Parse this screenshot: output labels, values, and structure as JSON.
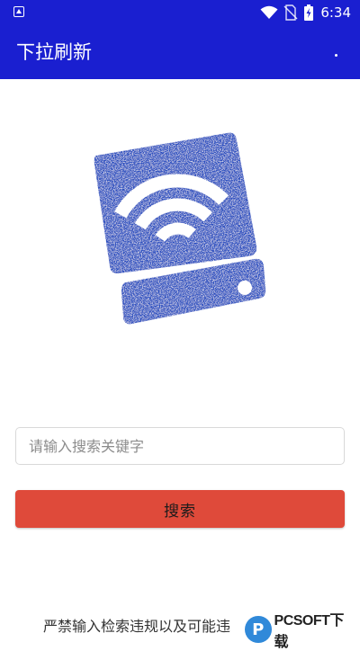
{
  "status_bar": {
    "time": "6:34",
    "icons": [
      "app-notification-icon",
      "wifi-icon",
      "no-sim-icon",
      "battery-icon"
    ]
  },
  "app_bar": {
    "title": "下拉刷新",
    "overflow_icon": "overflow-menu-icon"
  },
  "logo": {
    "icon": "wifi-router-logo",
    "color": "#2a4fc0"
  },
  "search": {
    "placeholder": "请输入搜索关键字",
    "value": "",
    "button_label": "搜索"
  },
  "footer": {
    "disclaimer": "严禁输入检索违规以及可能违"
  },
  "watermark": {
    "text": "PCSOFT下载"
  },
  "colors": {
    "primary": "#1a1fd0",
    "button": "#df4a3a",
    "logo": "#2a4fc0"
  }
}
